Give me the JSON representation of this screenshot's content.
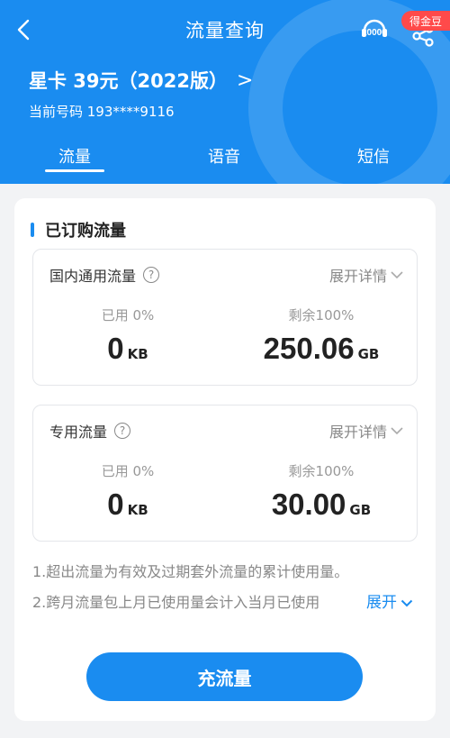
{
  "header": {
    "title": "流量查询",
    "service_number": "10000",
    "gold_badge": "得金豆",
    "plan_name": "星卡 39元（2022版）",
    "plan_chevron": ">",
    "phone_line": "当前号码 193****9116"
  },
  "tabs": [
    {
      "label": "流量",
      "active": true
    },
    {
      "label": "语音",
      "active": false
    },
    {
      "label": "短信",
      "active": false
    }
  ],
  "section": {
    "title": "已订购流量"
  },
  "boxes": [
    {
      "label": "国内通用流量",
      "help": "?",
      "expand": "展开详情",
      "used_label": "已用 0%",
      "used_value": "0",
      "used_unit": "KB",
      "remaining_label": "剩余100%",
      "remaining_value": "250.06",
      "remaining_unit": "GB"
    },
    {
      "label": "专用流量",
      "help": "?",
      "expand": "展开详情",
      "used_label": "已用 0%",
      "used_value": "0",
      "used_unit": "KB",
      "remaining_label": "剩余100%",
      "remaining_value": "30.00",
      "remaining_unit": "GB"
    }
  ],
  "notes": {
    "line1": "1.超出流量为有效及过期套外流量的累计使用量。",
    "line2": "2.跨月流量包上月已使用量会计入当月已使用",
    "expand": "展开"
  },
  "recharge_button": "充流量",
  "colors": {
    "primary": "#1a8cf0",
    "badge": "#ff4a4a"
  }
}
